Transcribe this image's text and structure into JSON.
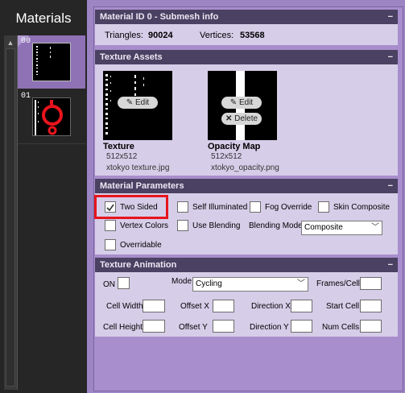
{
  "sidebar": {
    "title": "Materials",
    "scroll_up_glyph": "▲",
    "materials": [
      {
        "index": "00",
        "selected": true
      },
      {
        "index": "01",
        "selected": false
      }
    ]
  },
  "submesh": {
    "header": "Material ID 0 - Submesh info",
    "triangles_label": "Triangles:",
    "triangles_value": "90024",
    "vertices_label": "Vertices:",
    "vertices_value": "53568"
  },
  "texture_assets": {
    "header": "Texture Assets",
    "texture": {
      "title": "Texture",
      "size": "512x512",
      "file": "xtokyo texture.jpg",
      "edit_label": "Edit"
    },
    "opacity": {
      "title": "Opacity Map",
      "size": "512x512",
      "file": "xtokyo_opacity.png",
      "edit_label": "Edit",
      "delete_label": "Delete"
    }
  },
  "material_parameters": {
    "header": "Material Parameters",
    "two_sided": {
      "label": "Two Sided",
      "checked": true
    },
    "self_illuminated": {
      "label": "Self Illuminated",
      "checked": false
    },
    "fog_override": {
      "label": "Fog Override",
      "checked": false
    },
    "skin_composite": {
      "label": "Skin Composite",
      "checked": false
    },
    "vertex_colors": {
      "label": "Vertex Colors",
      "checked": false
    },
    "use_blending": {
      "label": "Use Blending",
      "checked": false
    },
    "blending_mode_label": "Blending Mode",
    "blending_mode_value": "Composite",
    "overridable": {
      "label": "Overridable",
      "checked": false
    }
  },
  "texture_animation": {
    "header": "Texture Animation",
    "on_label": "ON",
    "mode_label": "Mode",
    "mode_value": "Cycling",
    "frames_cell_label": "Frames/Cell",
    "cell_width_label": "Cell Width",
    "offset_x_label": "Offset X",
    "direction_x_label": "Direction X",
    "start_cell_label": "Start Cell",
    "cell_height_label": "Cell Height",
    "offset_y_label": "Offset Y",
    "direction_y_label": "Direction Y",
    "num_cells_label": "Num Cells"
  },
  "panel_collapse_glyph": "−",
  "colors": {
    "accent": "#9d85c3",
    "header": "#4b4162",
    "highlight": "#e8141d"
  }
}
